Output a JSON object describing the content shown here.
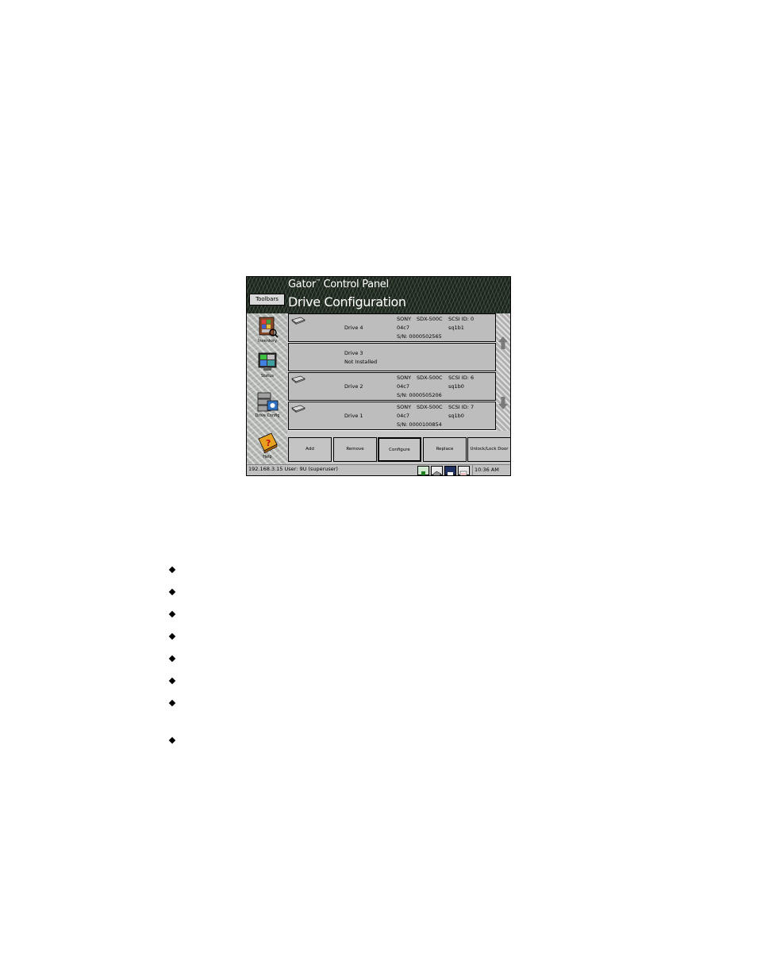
{
  "app": {
    "title": "Gator",
    "title_mark": "™",
    "title_suffix": " Control Panel",
    "page_title": "Drive Configuration",
    "toolbars_label": "Toolbars"
  },
  "sidebar": {
    "items": [
      {
        "label": "Inventory",
        "icon": "inventory-icon"
      },
      {
        "label": "Status",
        "icon": "status-icon"
      },
      {
        "label": "Drive Config",
        "icon": "drive-config-icon"
      },
      {
        "label": "Help",
        "icon": "help-icon"
      }
    ]
  },
  "drives": [
    {
      "name": "Drive 4",
      "status": "",
      "vendor": "SONY",
      "model": "SDX-500C",
      "rev": "04c7",
      "serial": "S/N: 0000502565",
      "scsi_id": "SCSI ID: 0",
      "device": "sq1b1",
      "installed": true
    },
    {
      "name": "Drive 3",
      "status": "Not Installed",
      "vendor": "",
      "model": "",
      "rev": "",
      "serial": "",
      "scsi_id": "",
      "device": "",
      "installed": false
    },
    {
      "name": "Drive 2",
      "status": "",
      "vendor": "SONY",
      "model": "SDX-500C",
      "rev": "04c7",
      "serial": "S/N: 0000505206",
      "scsi_id": "SCSI ID: 6",
      "device": "sq1b0",
      "installed": true
    },
    {
      "name": "Drive 1",
      "status": "",
      "vendor": "SONY",
      "model": "SDX-500C",
      "rev": "04c7",
      "serial": "S/N: 0000100854",
      "scsi_id": "SCSI ID: 7",
      "device": "sq1b0",
      "installed": true
    }
  ],
  "buttons": {
    "add": "Add",
    "remove": "Remove",
    "configure": "Configure",
    "replace": "Replace",
    "unlock": "Unlock/Lock Door"
  },
  "statusbar": {
    "text": "192.168.3.15 User: 9U (superuser)",
    "time": "10:36 AM"
  },
  "colors": {
    "title_bg": "#1c241c",
    "row_bg": "#bdbdbd",
    "panel_bg": "#c8c8c8"
  }
}
